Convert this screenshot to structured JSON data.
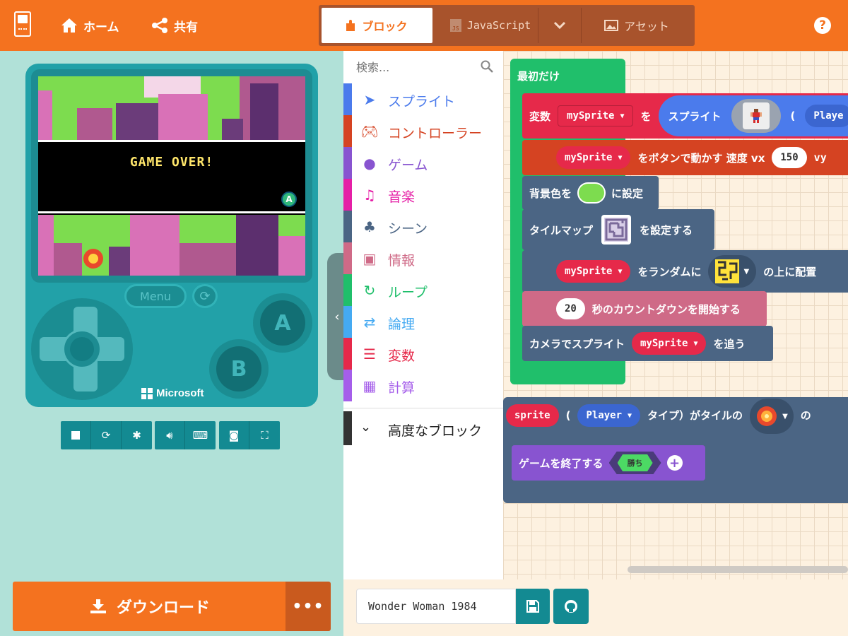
{
  "header": {
    "home_label": "ホーム",
    "share_label": "共有",
    "tabs": {
      "blocks": "ブロック",
      "javascript": "JavaScript",
      "assets": "アセット"
    },
    "help": "?"
  },
  "simulator": {
    "game_over_text": "GAME OVER!",
    "a_badge": "A",
    "menu_label": "Menu",
    "button_a": "A",
    "button_b": "B",
    "brand": "Microsoft",
    "download_label": "ダウンロード",
    "more_label": "•••"
  },
  "toolbox": {
    "search_placeholder": "検索...",
    "categories": [
      {
        "label": "スプライト",
        "color": "#4b7bec"
      },
      {
        "label": "コントローラー",
        "color": "#d54322"
      },
      {
        "label": "ゲーム",
        "color": "#8854d0"
      },
      {
        "label": "音楽",
        "color": "#e51fa6"
      },
      {
        "label": "シーン",
        "color": "#4b6584"
      },
      {
        "label": "情報",
        "color": "#cf6a87"
      },
      {
        "label": "ループ",
        "color": "#20bf6b"
      },
      {
        "label": "論理",
        "color": "#45aaf2"
      },
      {
        "label": "変数",
        "color": "#e6294a"
      },
      {
        "label": "計算",
        "color": "#a55eea"
      }
    ],
    "advanced_label": "高度なブロック"
  },
  "workspace": {
    "on_start": "最初だけ",
    "set_var": {
      "prefix": "変数",
      "var": "mySprite",
      "mid": "を",
      "sprite_label": "スプライト",
      "paren": "(",
      "kind": "Playe"
    },
    "move_buttons": {
      "var": "mySprite",
      "text": "をボタンで動かす 速度 vx",
      "vx": "150",
      "vy_label": "vy"
    },
    "bg_color": {
      "prefix": "背景色を",
      "suffix": "に設定",
      "color": "#7ddc4f"
    },
    "tilemap": {
      "prefix": "タイルマップ",
      "suffix": "を設定する"
    },
    "random_place": {
      "var": "mySprite",
      "text": "をランダムに",
      "suffix": "の上に配置"
    },
    "countdown": {
      "value": "20",
      "text": "秒のカウントダウンを開始する"
    },
    "camera": {
      "prefix": "カメラでスプライト",
      "var": "mySprite",
      "suffix": "を追う"
    },
    "overlap": {
      "sprite": "sprite",
      "paren": "(",
      "kind": "Player",
      "text": "タイプ）がタイルの",
      "tail": "の"
    },
    "game_over": {
      "text": "ゲームを終了する",
      "win": "勝ち"
    }
  },
  "footer": {
    "project_name": "Wonder Woman 1984"
  }
}
